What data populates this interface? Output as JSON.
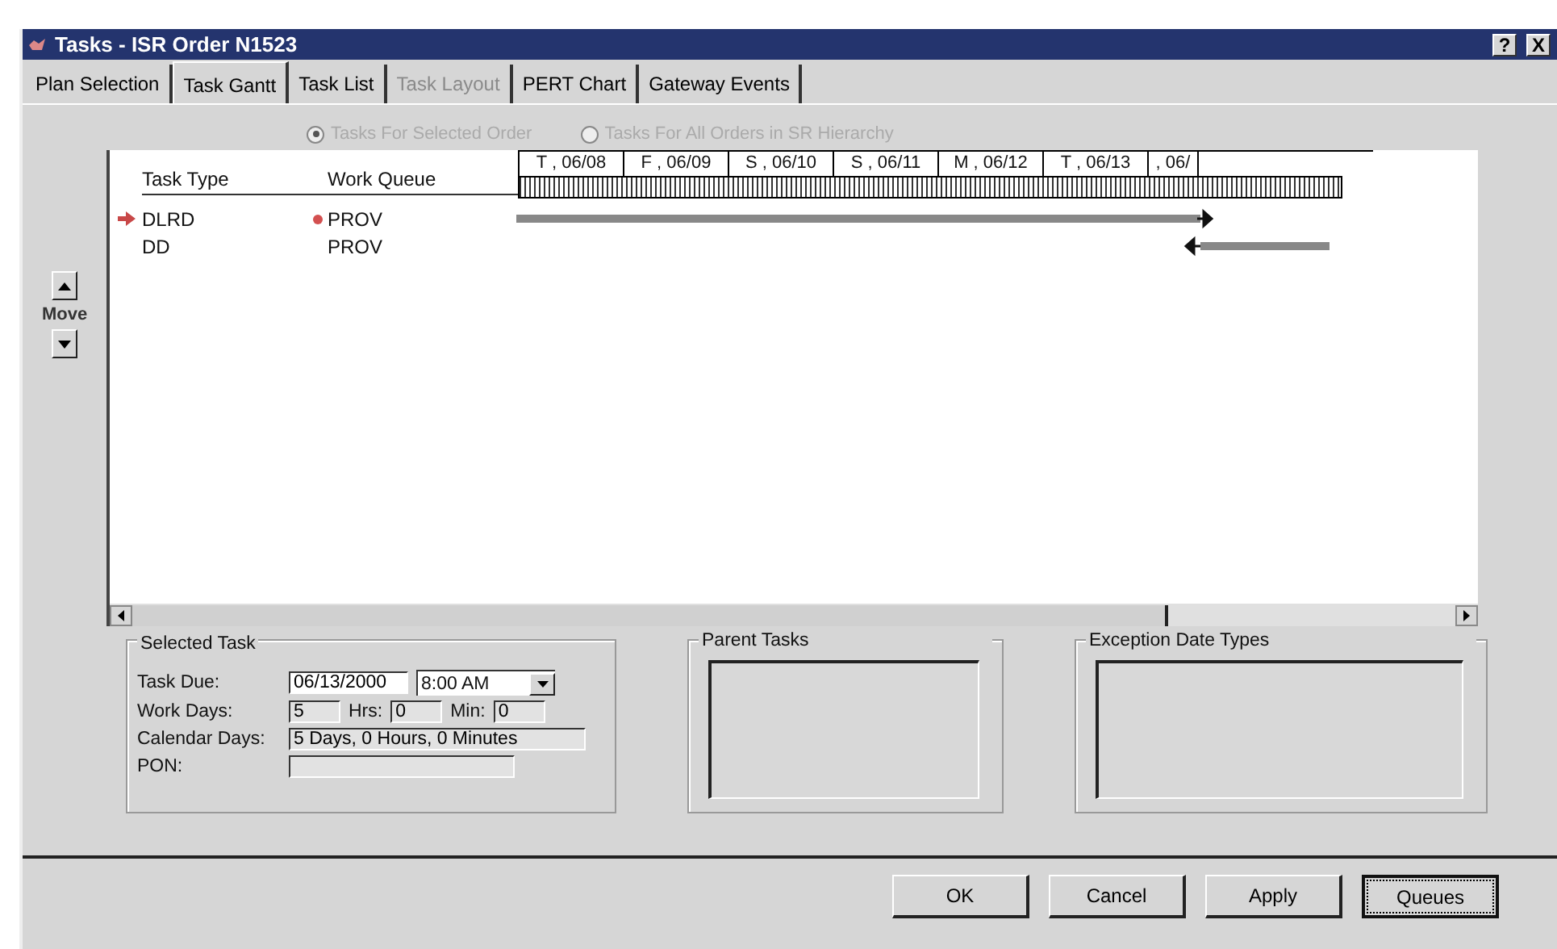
{
  "window": {
    "title": "Tasks - ISR Order N1523",
    "help_button": "?",
    "close_button": "X"
  },
  "tabs": [
    {
      "label": "Plan Selection",
      "selected": false,
      "disabled": false
    },
    {
      "label": "Task Gantt",
      "selected": true,
      "disabled": false
    },
    {
      "label": "Task List",
      "selected": false,
      "disabled": false
    },
    {
      "label": "Task Layout",
      "selected": false,
      "disabled": true
    },
    {
      "label": "PERT Chart",
      "selected": false,
      "disabled": false
    },
    {
      "label": "Gateway Events",
      "selected": false,
      "disabled": false
    }
  ],
  "scope_options": [
    {
      "label": "Tasks For Selected Order",
      "selected": true
    },
    {
      "label": "Tasks For All Orders in SR Hierarchy",
      "selected": false
    }
  ],
  "move": {
    "label": "Move"
  },
  "gantt": {
    "columns": [
      "Task Type",
      "Work Queue"
    ],
    "days": [
      "T , 06/08",
      "F , 06/09",
      "S , 06/10",
      "S , 06/11",
      "M , 06/12",
      "T , 06/13",
      ", 06/"
    ],
    "rows": [
      {
        "task_type": "DLRD",
        "work_queue": "PROV",
        "current": true,
        "flagged": true,
        "kind": "forward"
      },
      {
        "task_type": "DD",
        "work_queue": "PROV",
        "current": false,
        "flagged": false,
        "kind": "backward"
      }
    ]
  },
  "selected_task": {
    "title": "Selected Task",
    "task_due_label": "Task Due:",
    "task_due_date": "06/13/2000",
    "task_due_time": "8:00 AM",
    "work_days_label": "Work Days:",
    "work_days": "5",
    "hrs_label": "Hrs:",
    "hrs": "0",
    "min_label": "Min:",
    "min": "0",
    "calendar_days_label": "Calendar Days:",
    "calendar_days": "5 Days, 0 Hours, 0 Minutes",
    "pon_label": "PON:"
  },
  "parent_tasks": {
    "title": "Parent Tasks"
  },
  "exception_date_types": {
    "title": "Exception Date Types"
  },
  "buttons": [
    {
      "label": "OK",
      "focused": false
    },
    {
      "label": "Cancel",
      "focused": false
    },
    {
      "label": "Apply",
      "focused": false
    },
    {
      "label": "Queues",
      "focused": true
    }
  ]
}
